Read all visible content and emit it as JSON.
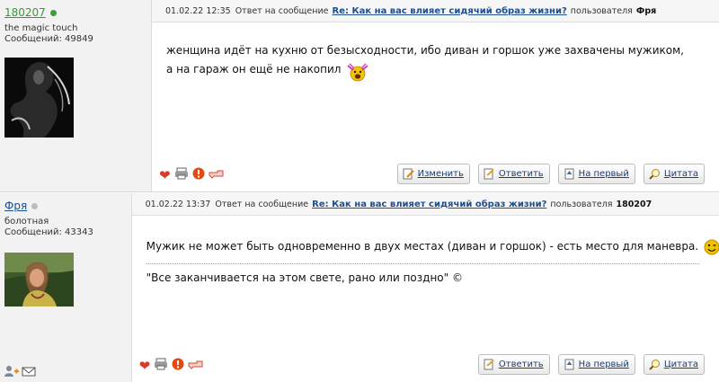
{
  "posts": [
    {
      "user": {
        "name": "180207",
        "status": "online",
        "title": "the magic touch",
        "count": "Сообщений: 49849"
      },
      "date": "01.02.22 12:35",
      "reply_prefix": "Ответ на сообщение",
      "reply_link": "Re: Как на вас влияет сидячий образ жизни?",
      "by_prefix": "пользователя",
      "by_user": "Фря",
      "lines": [
        "женщина идёт на кухню от безысходности, ибо диван и горшок уже захвачены мужиком,",
        "а на гараж он ещё не накопил"
      ],
      "buttons": {
        "edit": "Изменить",
        "reply": "Ответить",
        "first": "На первый",
        "quote": "Цитата"
      }
    },
    {
      "user": {
        "name": "Фря",
        "status": "offline",
        "title": "болотная",
        "count": "Сообщений: 43343"
      },
      "date": "01.02.22 13:37",
      "reply_prefix": "Ответ на сообщение",
      "reply_link": "Re: Как на вас влияет сидячий образ жизни?",
      "by_prefix": "пользователя",
      "by_user": "180207",
      "lines": [
        "Мужик не может быть одновременно в двух местах (диван и горшок) - есть место для маневра."
      ],
      "signature": "\"Все заканчивается на этом свете, рано или поздно\" ©",
      "buttons": {
        "reply": "Ответить",
        "first": "На первый",
        "quote": "Цитата"
      }
    }
  ],
  "icons": {
    "like": "heart-icon",
    "print": "printer-icon",
    "report": "warning-icon",
    "link": "pointer-hand-icon",
    "edit": "pencil-page-icon",
    "reply": "reply-page-icon",
    "first": "page-up-icon",
    "quote": "magnifier-icon",
    "add_friend": "add-friend-icon",
    "message": "envelope-icon"
  },
  "colors": {
    "online": "#3aa03a",
    "offline": "#bdbdbd",
    "link": "#1d4f91",
    "sidebar_bg": "#f2f2f2"
  }
}
